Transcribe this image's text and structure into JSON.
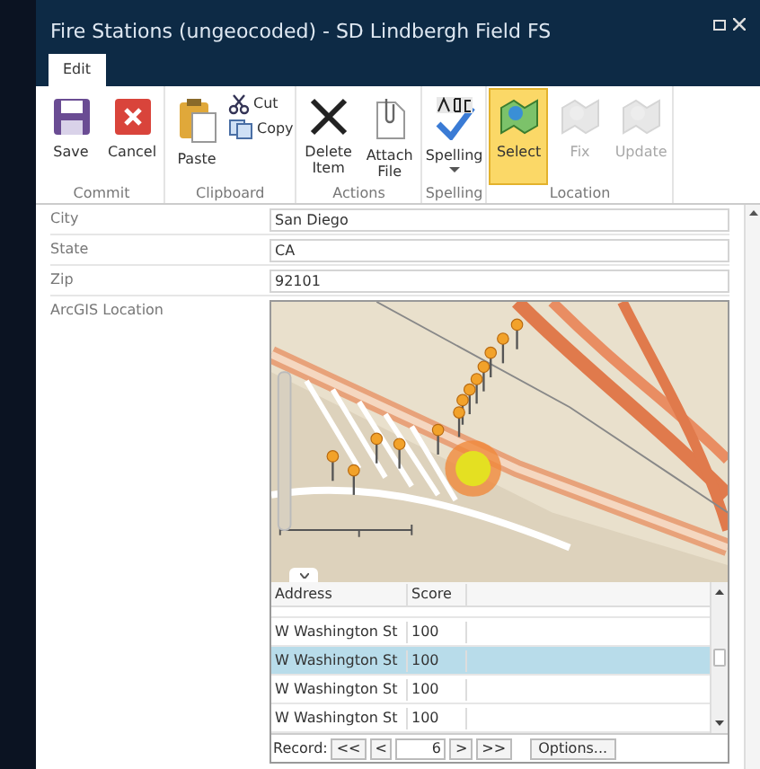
{
  "window": {
    "title": "Fire Stations (ungeocoded) - SD Lindbergh Field FS"
  },
  "tabs": [
    {
      "label": "Edit",
      "selected": true
    }
  ],
  "ribbon": {
    "groups": [
      {
        "label": "Commit",
        "buttons": [
          {
            "label": "Save",
            "kind": "save",
            "selected": false,
            "disabled": false
          },
          {
            "label": "Cancel",
            "kind": "cancel",
            "selected": false,
            "disabled": false
          }
        ]
      },
      {
        "label": "Clipboard",
        "buttons": [
          {
            "label": "Paste",
            "kind": "paste",
            "selected": false,
            "disabled": false
          }
        ],
        "small_buttons": [
          {
            "label": "Cut",
            "kind": "cut"
          },
          {
            "label": "Copy",
            "kind": "copy"
          }
        ]
      },
      {
        "label": "Actions",
        "buttons": [
          {
            "label": "Delete Item",
            "kind": "delete",
            "selected": false,
            "disabled": false
          },
          {
            "label": "Attach File",
            "kind": "attach",
            "selected": false,
            "disabled": false
          }
        ]
      },
      {
        "label": "Spelling",
        "buttons": [
          {
            "label": "Spelling",
            "kind": "spelling",
            "selected": false,
            "disabled": false,
            "dropdown": true
          }
        ]
      },
      {
        "label": "Location",
        "buttons": [
          {
            "label": "Select",
            "kind": "location",
            "selected": true,
            "disabled": false
          },
          {
            "label": "Fix",
            "kind": "location",
            "selected": false,
            "disabled": true
          },
          {
            "label": "Update",
            "kind": "location",
            "selected": false,
            "disabled": true
          }
        ]
      }
    ]
  },
  "form": {
    "fields": [
      {
        "label": "City",
        "value": "San Diego"
      },
      {
        "label": "State",
        "value": "CA"
      },
      {
        "label": "Zip",
        "value": "92101"
      }
    ],
    "location": {
      "label": "ArcGIS Location",
      "table": {
        "columns": [
          "Address",
          "Score"
        ],
        "rows": [
          {
            "address": "W Washington St",
            "score": "100",
            "selected": false
          },
          {
            "address": "W Washington St",
            "score": "100",
            "selected": true
          },
          {
            "address": "W Washington St",
            "score": "100",
            "selected": false
          },
          {
            "address": "W Washington St",
            "score": "100",
            "selected": false
          }
        ]
      },
      "pager": {
        "label": "Record:",
        "first": "<<",
        "prev": "<",
        "value": "6",
        "next": ">",
        "last": ">>",
        "options": "Options..."
      }
    }
  }
}
